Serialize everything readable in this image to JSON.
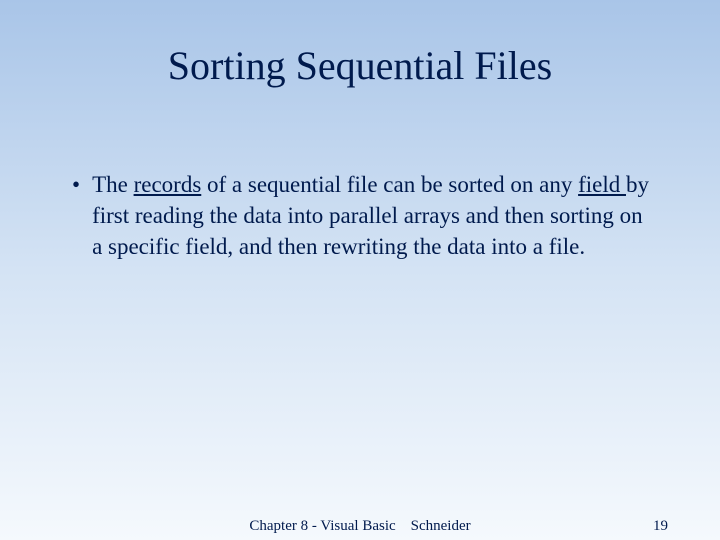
{
  "title": "Sorting Sequential Files",
  "bullet": {
    "text_before_records": "The ",
    "records": "records",
    "text_mid1": " of a sequential file can be sorted on any ",
    "field": "field ",
    "text_after": "by first reading the data into parallel arrays and then sorting on a specific field, and then rewriting the data into a file."
  },
  "footer": {
    "center": "Chapter 8 - Visual Basic Schneider",
    "page": "19"
  }
}
